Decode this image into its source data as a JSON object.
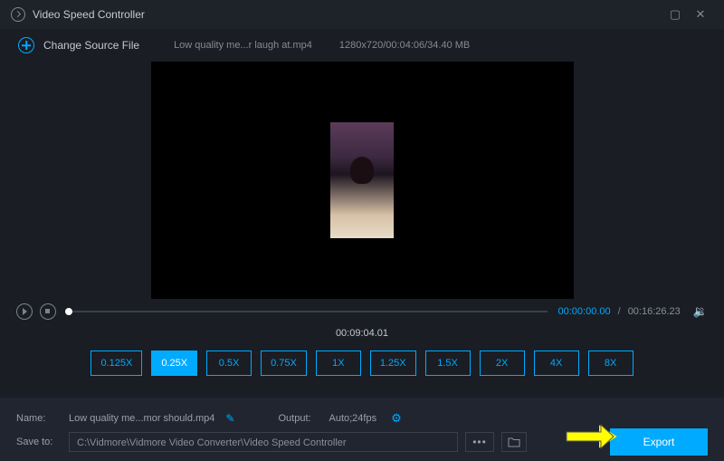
{
  "window": {
    "title": "Video Speed Controller"
  },
  "source": {
    "change_label": "Change Source File",
    "filename": "Low quality me...r laugh at.mp4",
    "meta": "1280x720/00:04:06/34.40 MB"
  },
  "playback": {
    "current": "00:00:00.00",
    "total": "00:16:26.23",
    "duration_display": "00:09:04.01"
  },
  "speeds": {
    "options": [
      "0.125X",
      "0.25X",
      "0.5X",
      "0.75X",
      "1X",
      "1.25X",
      "1.5X",
      "2X",
      "4X",
      "8X"
    ],
    "active_index": 1
  },
  "output": {
    "name_label": "Name:",
    "name_value": "Low quality me...mor should.mp4",
    "output_label": "Output:",
    "output_value": "Auto;24fps",
    "saveto_label": "Save to:",
    "saveto_value": "C:\\Vidmore\\Vidmore Video Converter\\Video Speed Controller",
    "export_label": "Export"
  }
}
